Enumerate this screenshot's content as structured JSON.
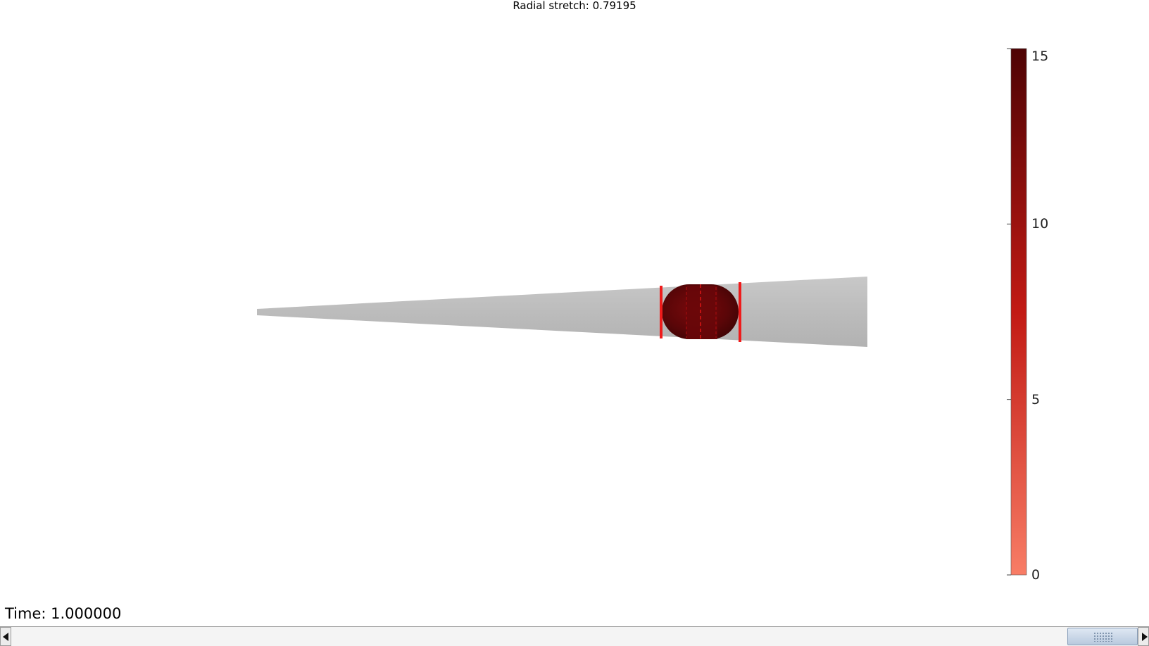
{
  "plot": {
    "title": "Radial stretch: 0.79195",
    "time_label": "Time: 1.000000"
  },
  "colorbar": {
    "min": 0,
    "max": 15,
    "ticks": [
      {
        "value": 15,
        "label": "15"
      },
      {
        "value": 10,
        "label": "10"
      },
      {
        "value": 5,
        "label": "5"
      },
      {
        "value": 0,
        "label": "0"
      }
    ],
    "color_low": "#f87d66",
    "color_mid": "#c21a14",
    "color_high": "#4e0304"
  },
  "colors": {
    "tube": "#bdbdbd",
    "capsule": "#5a0608",
    "ring": "#ef1b1b",
    "background": "#ffffff"
  },
  "scrollbar": {
    "position_fraction": 1.0
  }
}
